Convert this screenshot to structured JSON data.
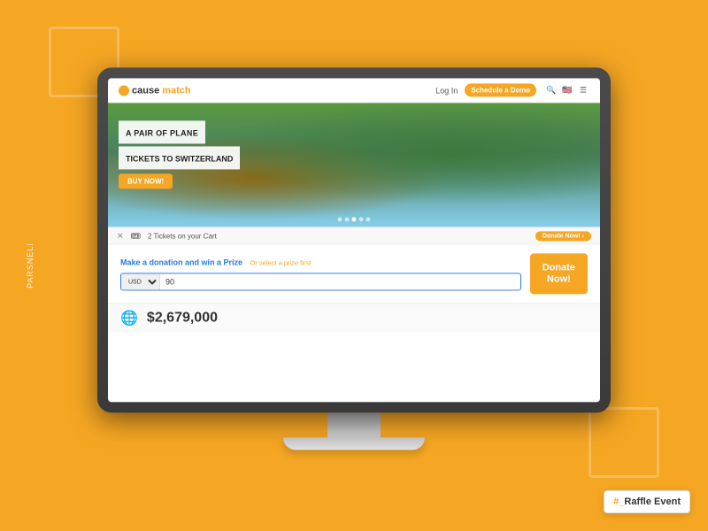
{
  "page": {
    "background_color": "#F5A623"
  },
  "side_label": "PARSNELI",
  "monitor": {
    "visible": true
  },
  "navbar": {
    "logo_cause": "cause",
    "logo_match": "match",
    "login_label": "Log In",
    "schedule_label": "Schedule a Demo",
    "search_icon": "🔍",
    "flag_icon": "🇺🇸",
    "menu_icon": "☰"
  },
  "hero": {
    "line1": "A PAIR OF PLANE",
    "line2": "TICKETS TO SWITZERLAND",
    "buy_btn": "BUY NOW!",
    "dots": [
      false,
      false,
      true,
      false,
      false
    ]
  },
  "notif_bar": {
    "ticket_icon": "🎟",
    "text": "2 Tickets on your Cart",
    "btn_label": "Donate Now! ›",
    "close_icon": "✕"
  },
  "donation": {
    "label": "Make a donation and win a Prize",
    "sublabel": "Or select a prize first",
    "currency": "USD",
    "amount": "90",
    "donate_btn_line1": "Donate",
    "donate_btn_line2": "Now!"
  },
  "stats": {
    "icon": "🌐",
    "amount": "$2,679,000"
  },
  "raffle_badge": {
    "prefix": "#_",
    "label": "Raffle Event"
  }
}
